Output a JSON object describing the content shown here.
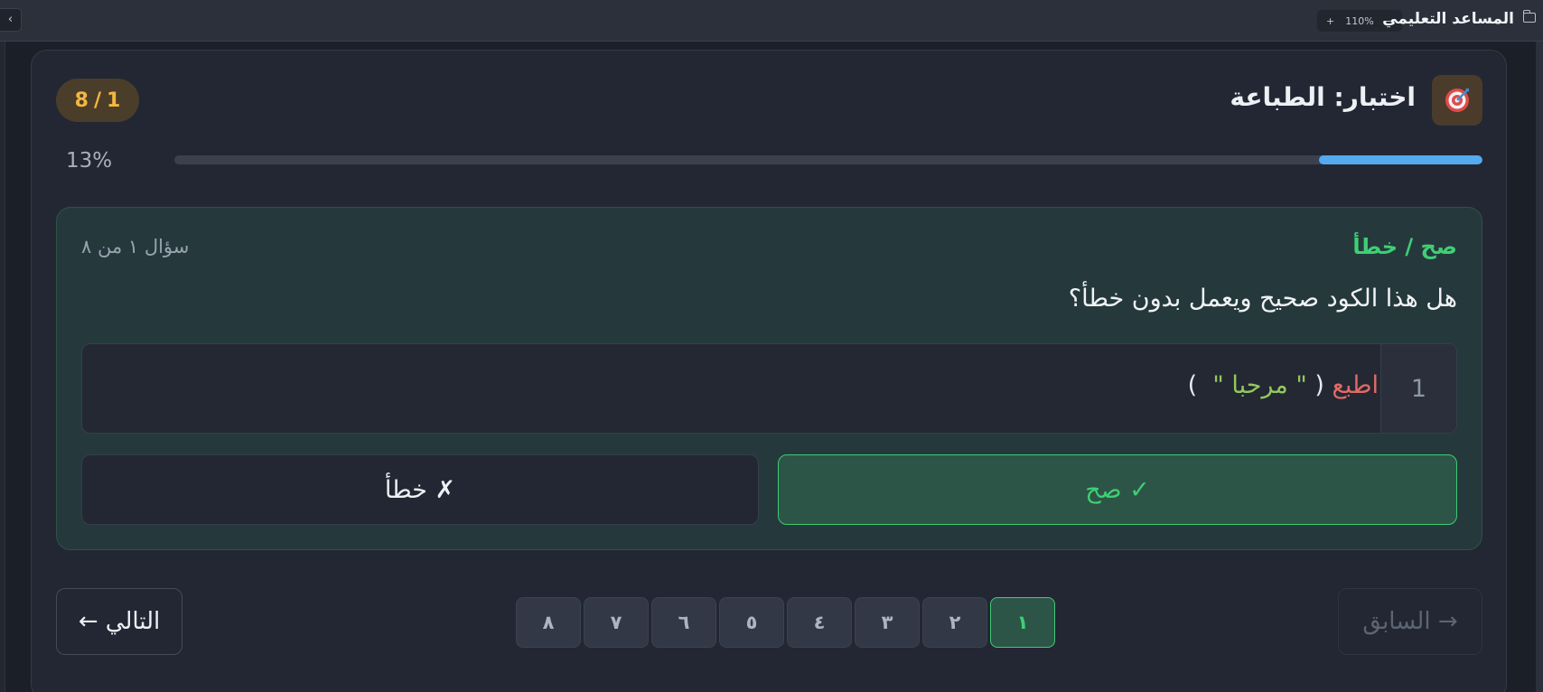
{
  "app": {
    "title": "المساعد التعليمي",
    "zoom": {
      "minus": "−",
      "level": "110%",
      "plus": "+"
    },
    "collapse_label": "‹"
  },
  "quiz": {
    "title": "اختبار: الطباعة",
    "icon": "target-icon",
    "counter": {
      "current": "1",
      "separator": "/",
      "total": "8"
    },
    "progress": {
      "label": "13%",
      "fraction": 0.125
    }
  },
  "question": {
    "type_label": "صح / خطأ",
    "number_label": "سؤال ١ من ٨",
    "text": "هل هذا الكود صحيح ويعمل بدون خطأ؟",
    "code": {
      "line_number": "1",
      "keyword": "اطبع",
      "open_paren": " ( ",
      "string": "\" مرحبا \"",
      "close_paren": "  )"
    },
    "answers": {
      "true_label": "صح ✓",
      "false_label": "خطأ ✗"
    }
  },
  "navigation": {
    "next_label": "التالي ←",
    "prev_label": "→ السابق",
    "pages": [
      "١",
      "٢",
      "٣",
      "٤",
      "٥",
      "٦",
      "٧",
      "٨"
    ],
    "active_page": 0
  },
  "colors": {
    "accent_green": "#3fcf73",
    "progress_blue": "#54aaef",
    "badge_amber": "#f4b63f",
    "code_keyword": "#e06a66",
    "code_string": "#93c85e"
  }
}
